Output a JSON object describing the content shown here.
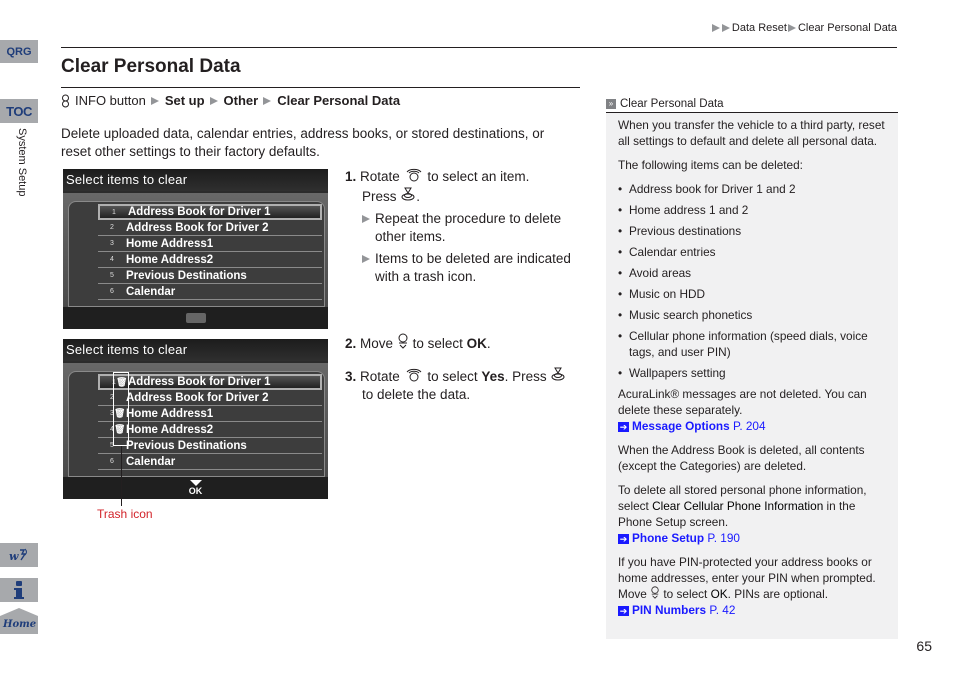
{
  "side_nav": {
    "qrg_label": "QRG",
    "toc_label": "TOC",
    "section_label": "System Setup",
    "voice_icon": "voice-command-icon",
    "info_icon": "info-icon",
    "home_label": "Home"
  },
  "breadcrumb": {
    "items": [
      "Data Reset",
      "Clear Personal Data"
    ]
  },
  "page": {
    "title": "Clear Personal Data",
    "nav_path": {
      "start": "INFO button",
      "steps": [
        "Set up",
        "Other",
        "Clear Personal Data"
      ]
    },
    "intro": "Delete uploaded data, calendar entries, address books, or stored destinations, or reset other settings to their factory defaults.",
    "page_number": "65"
  },
  "screens": [
    {
      "header": "Select items to clear",
      "rows": [
        {
          "num": "1",
          "label": "Address Book for Driver 1",
          "selected": true,
          "trash": false
        },
        {
          "num": "2",
          "label": "Address Book for Driver 2",
          "selected": false,
          "trash": false
        },
        {
          "num": "3",
          "label": "Home Address1",
          "selected": false,
          "trash": false
        },
        {
          "num": "4",
          "label": "Home Address2",
          "selected": false,
          "trash": false
        },
        {
          "num": "5",
          "label": "Previous Destinations",
          "selected": false,
          "trash": false
        },
        {
          "num": "6",
          "label": "Calendar",
          "selected": false,
          "trash": false
        }
      ]
    },
    {
      "header": "Select items to clear",
      "rows": [
        {
          "num": "1",
          "label": "Address Book for Driver 1",
          "selected": true,
          "trash": true
        },
        {
          "num": "2",
          "label": "Address Book for Driver 2",
          "selected": false,
          "trash": false
        },
        {
          "num": "3",
          "label": "Home Address1",
          "selected": false,
          "trash": true
        },
        {
          "num": "4",
          "label": "Home Address2",
          "selected": false,
          "trash": true
        },
        {
          "num": "5",
          "label": "Previous Destinations",
          "selected": false,
          "trash": false
        },
        {
          "num": "6",
          "label": "Calendar",
          "selected": false,
          "trash": false
        }
      ],
      "ok_label": "OK",
      "callout": "Trash icon"
    }
  ],
  "steps": {
    "s1_num": "1.",
    "s1_a": "Rotate",
    "s1_b": "to select an item.",
    "s1_c": "Press",
    "s1_d": ".",
    "s1_sub1": "Repeat the procedure to delete other items.",
    "s1_sub2": "Items to be deleted are indicated with a trash icon.",
    "s2_num": "2.",
    "s2_a": "Move",
    "s2_b": "to select",
    "s2_ok": "OK",
    "s2_c": ".",
    "s3_num": "3.",
    "s3_a": "Rotate",
    "s3_b": "to select",
    "s3_yes": "Yes",
    "s3_c": ". Press",
    "s3_d": "to delete the data."
  },
  "note": {
    "header": "Clear Personal Data",
    "p1": "When you transfer the vehicle to a third party, reset all settings to default and delete all personal data.",
    "p2": "The following items can be deleted:",
    "items": [
      "Address book for Driver 1 and 2",
      "Home address 1 and 2",
      "Previous destinations",
      "Calendar entries",
      "Avoid areas",
      "Music on HDD",
      "Music search phonetics",
      "Cellular phone information (speed dials, voice tags, and user PIN)",
      "Wallpapers setting"
    ],
    "p3": "AcuraLink® messages are not deleted. You can delete these separately.",
    "xref1": {
      "label": "Message Options",
      "page": "P. 204"
    },
    "p4": "When the Address Book is deleted, all contents (except the Categories) are deleted.",
    "p5_a": "To delete all stored personal phone information, select ",
    "p5_b": "Clear Cellular Phone Information",
    "p5_c": " in the Phone Setup screen.",
    "xref2": {
      "label": "Phone Setup",
      "page": "P. 190"
    },
    "p6_a": "If you have PIN-protected your address books or home addresses, enter your PIN when prompted. Move ",
    "p6_b": " to select ",
    "p6_ok": "OK",
    "p6_c": ". PINs are optional.",
    "xref3": {
      "label": "PIN Numbers",
      "page": "P. 42"
    }
  }
}
